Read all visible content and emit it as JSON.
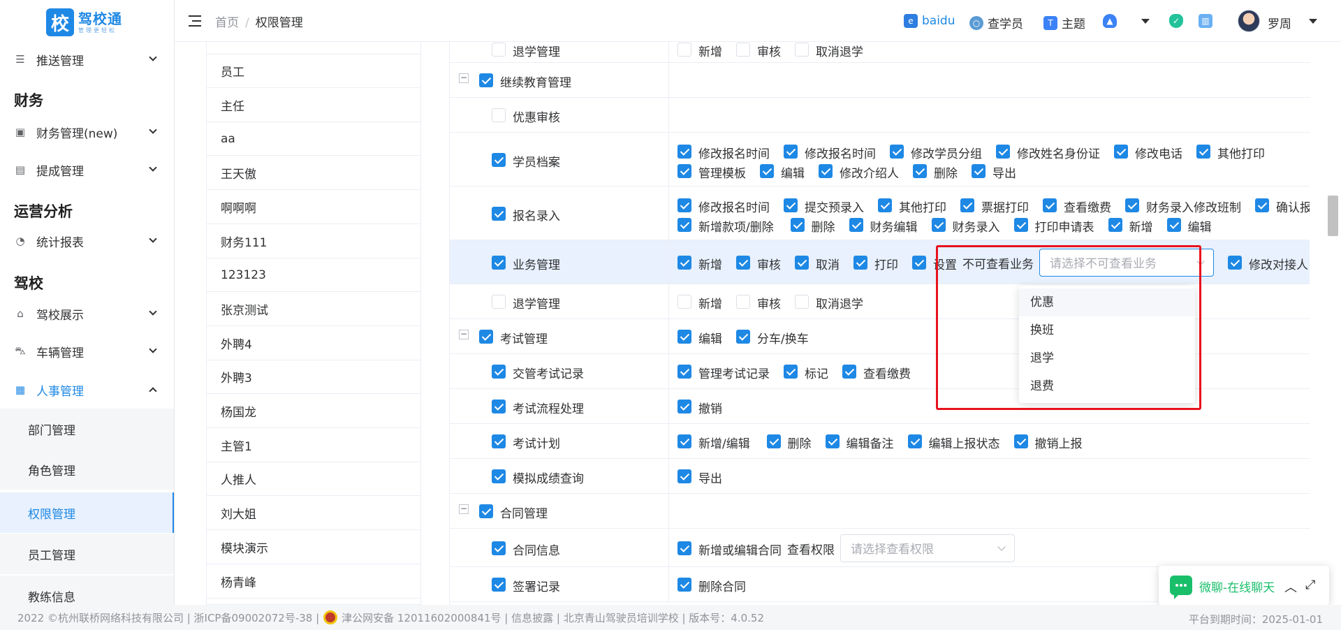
{
  "sidebar": {
    "logo": {
      "mark": "校",
      "name": "驾校通",
      "slogan": "管理更轻松"
    },
    "items": [
      {
        "label": "推送管理",
        "icon": "push-icon"
      },
      {
        "group": "财务"
      },
      {
        "label": "财务管理(new)",
        "icon": "wallet-icon"
      },
      {
        "label": "提成管理",
        "icon": "commission-icon"
      },
      {
        "group": "运营分析"
      },
      {
        "label": "统计报表",
        "icon": "pie-chart-icon"
      },
      {
        "group": "驾校"
      },
      {
        "label": "驾校展示",
        "icon": "school-icon"
      },
      {
        "label": "车辆管理",
        "icon": "car-icon"
      },
      {
        "label": "人事管理",
        "icon": "hr-icon",
        "expanded": true
      }
    ],
    "hr_sub_items": [
      "部门管理",
      "角色管理",
      "权限管理",
      "员工管理",
      "教练信息"
    ],
    "active_sub": "权限管理"
  },
  "header": {
    "breadcrumb": [
      "首页",
      "权限管理"
    ],
    "links": [
      "baidu",
      "查学员",
      "主题"
    ],
    "user": "罗周"
  },
  "roles": [
    "员工",
    "主任",
    "aa",
    "王天傲",
    "啊啊啊",
    "财务111",
    "123123",
    "张京测试",
    "外聘4",
    "外聘3",
    "杨国龙",
    "主管1",
    "人推人",
    "刘大姐",
    "模块演示",
    "杨青峰"
  ],
  "permissions": [
    {
      "name": "退学管理",
      "level": 2,
      "checked": false,
      "ops": [
        [
          "新增",
          false
        ],
        [
          "审核",
          false
        ],
        [
          "取消退学",
          false
        ]
      ]
    },
    {
      "name": "继续教育管理",
      "level": 1,
      "checked": true,
      "ops": []
    },
    {
      "name": "优惠审核",
      "level": 2,
      "checked": false,
      "ops": []
    },
    {
      "name": "学员档案",
      "level": 2,
      "checked": true,
      "ops": [
        [
          "修改报名时间",
          true
        ],
        [
          "修改报名时间",
          true
        ],
        [
          "修改学员分组",
          true
        ],
        [
          "修改姓名身份证",
          true
        ],
        [
          "修改电话",
          true
        ],
        [
          "其他打印",
          true
        ]
      ],
      "ops2": [
        [
          "管理模板",
          true
        ],
        [
          "编辑",
          true
        ],
        [
          "修改介绍人",
          true
        ],
        [
          "删除",
          true
        ],
        [
          "导出",
          true
        ]
      ]
    },
    {
      "name": "报名录入",
      "level": 2,
      "checked": true,
      "ops": [
        [
          "修改报名时间",
          true
        ],
        [
          "提交预录入",
          true
        ],
        [
          "其他打印",
          true
        ],
        [
          "票据打印",
          true
        ],
        [
          "查看缴费",
          true
        ],
        [
          "财务录入修改班制",
          true
        ],
        [
          "确认报名",
          true
        ]
      ],
      "ops2": [
        [
          "新增款项/删除",
          true
        ],
        [
          "删除",
          true
        ],
        [
          "财务编辑",
          true
        ],
        [
          "财务录入",
          true
        ],
        [
          "打印申请表",
          true
        ],
        [
          "新增",
          true
        ],
        [
          "编辑",
          true
        ]
      ]
    },
    {
      "name": "业务管理",
      "level": 2,
      "checked": true,
      "ops": [
        [
          "新增",
          true
        ],
        [
          "审核",
          true
        ],
        [
          "取消",
          true
        ],
        [
          "打印",
          true
        ],
        [
          "设置",
          true
        ]
      ],
      "select_label": "不可查看业务",
      "select_placeholder": "请选择不可查看业务",
      "after_select": [
        [
          "修改对接人",
          true
        ]
      ]
    },
    {
      "name": "退学管理",
      "level": 2,
      "checked": false,
      "ops": [
        [
          "新增",
          false
        ],
        [
          "审核",
          false
        ],
        [
          "取消退学",
          false
        ]
      ]
    },
    {
      "name": "考试管理",
      "level": 1,
      "checked": true,
      "ops": [
        [
          "编辑",
          true
        ],
        [
          "分车/换车",
          true
        ]
      ]
    },
    {
      "name": "交管考试记录",
      "level": 2,
      "checked": true,
      "ops": [
        [
          "管理考试记录",
          true
        ],
        [
          "标记",
          true
        ],
        [
          "查看缴费",
          true
        ]
      ]
    },
    {
      "name": "考试流程处理",
      "level": 2,
      "checked": true,
      "ops": [
        [
          "撤销",
          true
        ]
      ]
    },
    {
      "name": "考试计划",
      "level": 2,
      "checked": true,
      "ops": [
        [
          "新增/编辑",
          true
        ],
        [
          "删除",
          true
        ],
        [
          "编辑备注",
          true
        ],
        [
          "编辑上报状态",
          true
        ],
        [
          "撤销上报",
          true
        ]
      ]
    },
    {
      "name": "模拟成绩查询",
      "level": 2,
      "checked": true,
      "ops": [
        [
          "导出",
          true
        ]
      ]
    },
    {
      "name": "合同管理",
      "level": 1,
      "checked": true,
      "ops": []
    },
    {
      "name": "合同信息",
      "level": 2,
      "checked": true,
      "ops": [
        [
          "新增或编辑合同",
          true
        ]
      ],
      "select_label": "查看权限",
      "select_placeholder": "请选择查看权限"
    },
    {
      "name": "签署记录",
      "level": 2,
      "checked": true,
      "ops": [
        [
          "删除合同",
          true
        ]
      ]
    }
  ],
  "dropdown": {
    "options": [
      "优惠",
      "换班",
      "退学",
      "退费"
    ]
  },
  "chat": {
    "label": "微聊-在线聊天"
  },
  "footer": {
    "left": "2022 ©杭州联桥网络科技有限公司 | 浙ICP备09002072号-38 |",
    "police": "津公网安备 12011602000841号 | 信息披露 | 北京青山驾驶员培训学校 | 版本号：4.0.52",
    "right": "平台到期时间：2025-01-01"
  },
  "colors": {
    "accent": "#1e88e5",
    "highlight_row": "#e8f1fd",
    "annotation": "#e8121d",
    "chat": "#19be6b"
  }
}
